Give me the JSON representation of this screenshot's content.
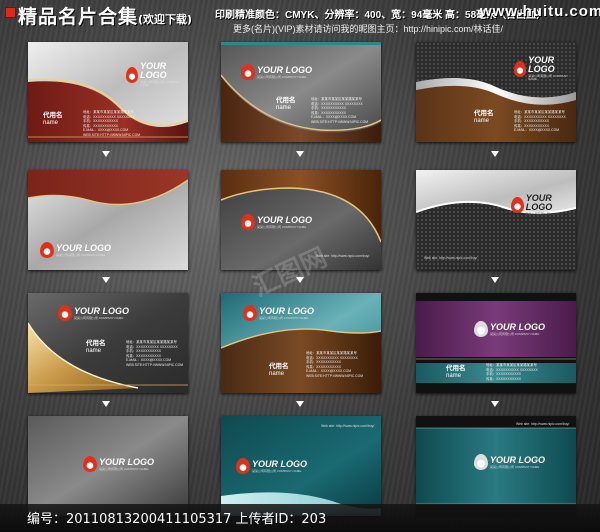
{
  "header": {
    "title": "精品名片合集",
    "subtitle": "(欢迎下载)",
    "info_line1": "印刷精准颜色：CMYK、分辨率：400、宽：94毫米 高：58毫米（含出血）",
    "info_line2": "更多(名片)(VIP)素材请访问我的昵图主页：http://hinipic.com/林话佳/",
    "site": "www.huitu.com"
  },
  "card_text": {
    "logo": "YOUR LOGO",
    "logo_sub": "某某公司有限公司 COMPANY NAME",
    "title_cn": "代用名",
    "title_en": "name",
    "address": "地址：某某市某某区某某路某某号",
    "phone": "电话：XXXXXXXXXX XXXXXXXX",
    "mobile": "手机：XXXXXXXXXXX",
    "fax": "传真：XXXXXXXXXXX",
    "email": "E-MAIL：XXXX@XXXX.COM",
    "web": "WEB SITE:HTTP://WWW.NIPIC.COM",
    "web_short": "Web site: http://www.nipic.com/buy/"
  },
  "watermark": {
    "brand": "汇图网"
  },
  "footer": {
    "text": "编号：20110813200411105317 上传者ID：203"
  },
  "colors": {
    "header_mark": "#d92a1c",
    "red_card": "#8a2a22",
    "brown_card": "#5a2e14",
    "gold_swoosh": "#d8b060",
    "teal_card": "#2a7a82",
    "purple_card": "#6a2a6a"
  }
}
